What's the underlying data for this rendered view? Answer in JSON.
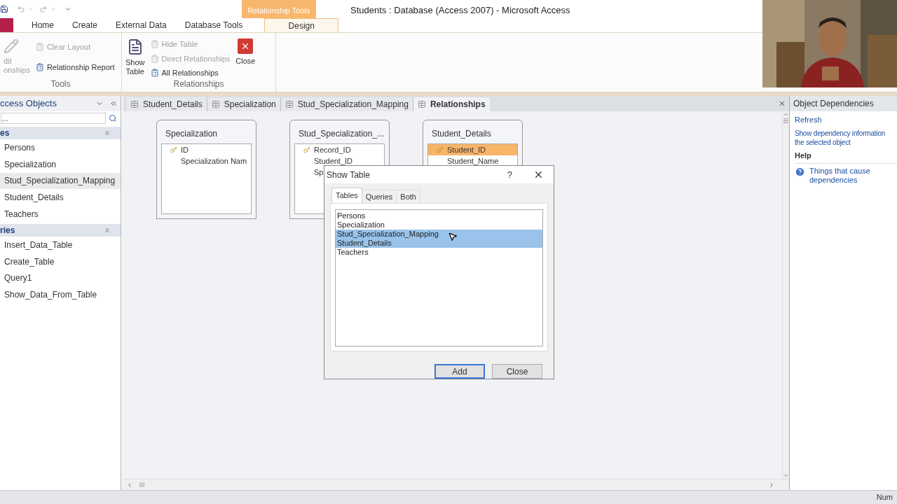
{
  "window": {
    "title": "Students : Database (Access 2007)  -  Microsoft Access"
  },
  "ribbon": {
    "contextual_label": "Relationship Tools",
    "tabs": [
      {
        "label": "Home",
        "selected": false
      },
      {
        "label": "Create",
        "selected": false
      },
      {
        "label": "External Data",
        "selected": false
      },
      {
        "label": "Database Tools",
        "selected": false
      },
      {
        "label": "Design",
        "selected": true
      }
    ],
    "groups": [
      {
        "label": "Tools",
        "items": [
          {
            "kind": "large",
            "lines": [
              "dit",
              "onships"
            ],
            "disabled": true
          },
          {
            "kind": "small",
            "label": "Clear Layout",
            "disabled": true
          },
          {
            "kind": "small",
            "label": "Relationship Report",
            "disabled": false
          }
        ]
      },
      {
        "label": "Relationships",
        "items": [
          {
            "kind": "large",
            "lines": [
              "Show",
              "Table"
            ],
            "disabled": false
          },
          {
            "kind": "small",
            "label": "Hide Table",
            "disabled": true
          },
          {
            "kind": "small",
            "label": "Direct Relationships",
            "disabled": true
          },
          {
            "kind": "small",
            "label": "All Relationships",
            "disabled": false
          },
          {
            "kind": "close",
            "lines": [
              "Close"
            ],
            "disabled": false
          }
        ]
      }
    ]
  },
  "nav_pane": {
    "title": "ccess Objects",
    "search_placeholder": "…",
    "groups": [
      {
        "label": "es",
        "items": [
          {
            "label": "Persons",
            "selected": false
          },
          {
            "label": "Specialization",
            "selected": false
          },
          {
            "label": "Stud_Specialization_Mapping",
            "selected": true
          },
          {
            "label": "Student_Details",
            "selected": false
          },
          {
            "label": "Teachers",
            "selected": false
          }
        ]
      },
      {
        "label": "ries",
        "items": [
          {
            "label": "Insert_Data_Table",
            "selected": false
          },
          {
            "label": "Create_Table",
            "selected": false
          },
          {
            "label": "Query1",
            "selected": false
          },
          {
            "label": "Show_Data_From_Table",
            "selected": false
          }
        ]
      }
    ]
  },
  "doc_tabs": [
    {
      "label": "Student_Details",
      "selected": false
    },
    {
      "label": "Specialization",
      "selected": false
    },
    {
      "label": "Stud_Specialization_Mapping",
      "selected": false
    },
    {
      "label": "Relationships",
      "selected": true
    }
  ],
  "tables": [
    {
      "title": "Specialization",
      "fields": [
        {
          "name": "ID",
          "primary_key": true,
          "selected": false
        },
        {
          "name": "Specialization Nam",
          "primary_key": false,
          "selected": false
        }
      ]
    },
    {
      "title": "Stud_Specialization_...",
      "fields": [
        {
          "name": "Record_ID",
          "primary_key": true,
          "selected": false
        },
        {
          "name": "Student_ID",
          "primary_key": false,
          "selected": false
        },
        {
          "name": "Sp",
          "primary_key": false,
          "selected": false
        }
      ]
    },
    {
      "title": "Student_Details",
      "fields": [
        {
          "name": "Student_ID",
          "primary_key": true,
          "selected": true
        },
        {
          "name": "Student_Name",
          "primary_key": false,
          "selected": false
        }
      ]
    }
  ],
  "dialog": {
    "title": "Show Table",
    "help": "?",
    "tabs": [
      {
        "label": "Tables",
        "selected": true
      },
      {
        "label": "Queries",
        "selected": false
      },
      {
        "label": "Both",
        "selected": false
      }
    ],
    "items": [
      {
        "label": "Persons",
        "selected": false
      },
      {
        "label": "Specialization",
        "selected": false
      },
      {
        "label": "Stud_Specialization_Mapping",
        "selected": true
      },
      {
        "label": "Student_Details",
        "selected": true
      },
      {
        "label": "Teachers",
        "selected": false
      }
    ],
    "buttons": [
      {
        "label": "Add",
        "default": true
      },
      {
        "label": "Close",
        "default": false
      }
    ]
  },
  "task_pane": {
    "title": "Object Dependencies",
    "links": [
      "Refresh"
    ],
    "info_lines": [
      "Show dependency information",
      "the selected object"
    ],
    "help_title": "Help",
    "help_link": "Things that cause dependencies"
  },
  "status_bar": {
    "right": "Num"
  }
}
